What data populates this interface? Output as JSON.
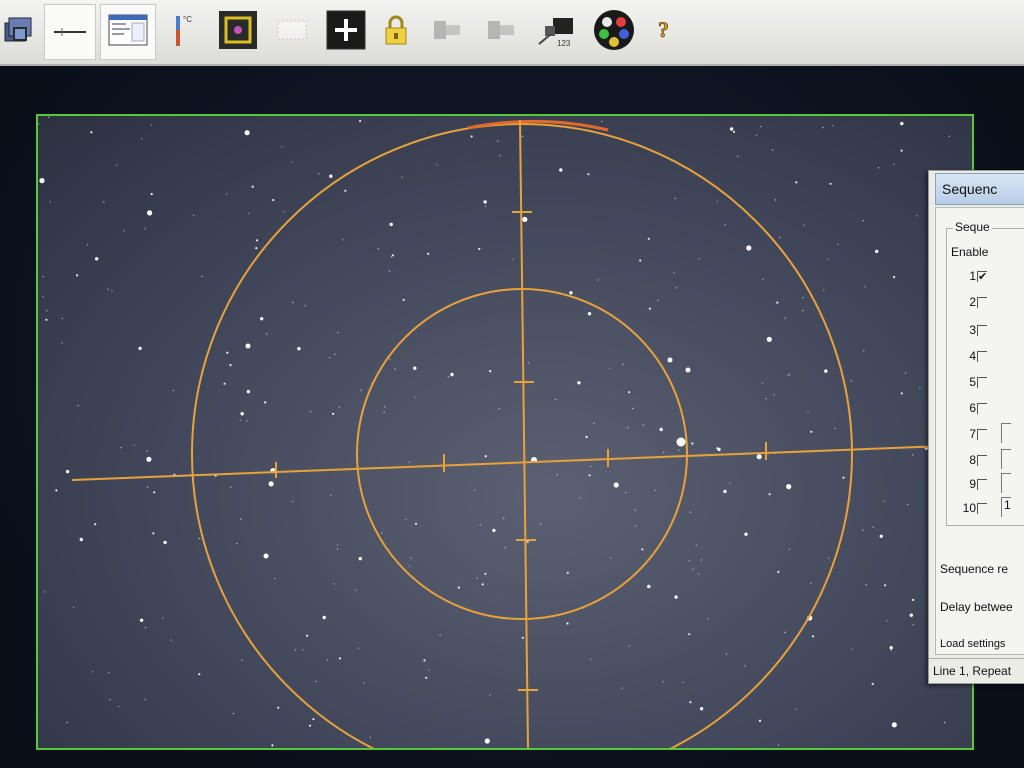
{
  "toolbar": {
    "buttons": [
      {
        "id": "camera",
        "icon": "camera-icon"
      },
      {
        "id": "stretch",
        "icon": "histogram-icon"
      },
      {
        "id": "window",
        "icon": "window-icon"
      },
      {
        "id": "temperature",
        "icon": "thermometer-icon",
        "label": "°C"
      },
      {
        "id": "focus-frame",
        "icon": "focus-frame-icon"
      },
      {
        "id": "subframe",
        "icon": "subframe-icon"
      },
      {
        "id": "crosshair",
        "icon": "crosshair-icon"
      },
      {
        "id": "lock",
        "icon": "lock-icon"
      },
      {
        "id": "filter1",
        "icon": "filter-icon"
      },
      {
        "id": "filter2",
        "icon": "filter-icon"
      },
      {
        "id": "calibrate",
        "icon": "calibrate-icon",
        "label": "123"
      },
      {
        "id": "color-wheel",
        "icon": "color-wheel-icon"
      },
      {
        "id": "help",
        "icon": "help-icon",
        "label": "?"
      }
    ]
  },
  "colors": {
    "accent_frame": "#58c83a",
    "reticle": "#e8a23a",
    "reticle_top": "#e06a2a"
  },
  "sequence_dialog": {
    "title": "Sequenc",
    "group_label": "Seque",
    "enable_header": "Enable",
    "rows": [
      {
        "num": "1",
        "checked": true,
        "check_mark": "✔"
      },
      {
        "num": "2",
        "checked": false,
        "check_mark": ""
      },
      {
        "num": "3",
        "checked": false,
        "check_mark": ""
      },
      {
        "num": "4",
        "checked": false,
        "check_mark": ""
      },
      {
        "num": "5",
        "checked": false,
        "check_mark": ""
      },
      {
        "num": "6",
        "checked": false,
        "check_mark": ""
      },
      {
        "num": "7",
        "checked": false,
        "check_mark": ""
      },
      {
        "num": "8",
        "checked": false,
        "check_mark": ""
      },
      {
        "num": "9",
        "checked": false,
        "check_mark": ""
      },
      {
        "num": "10",
        "checked": false,
        "check_mark": ""
      }
    ],
    "row10_extra": "1",
    "sequence_repeat_label": "Sequence re",
    "delay_label": "Delay betwee",
    "load_settings_label": "Load settings",
    "status_text": "Line 1, Repeat"
  }
}
